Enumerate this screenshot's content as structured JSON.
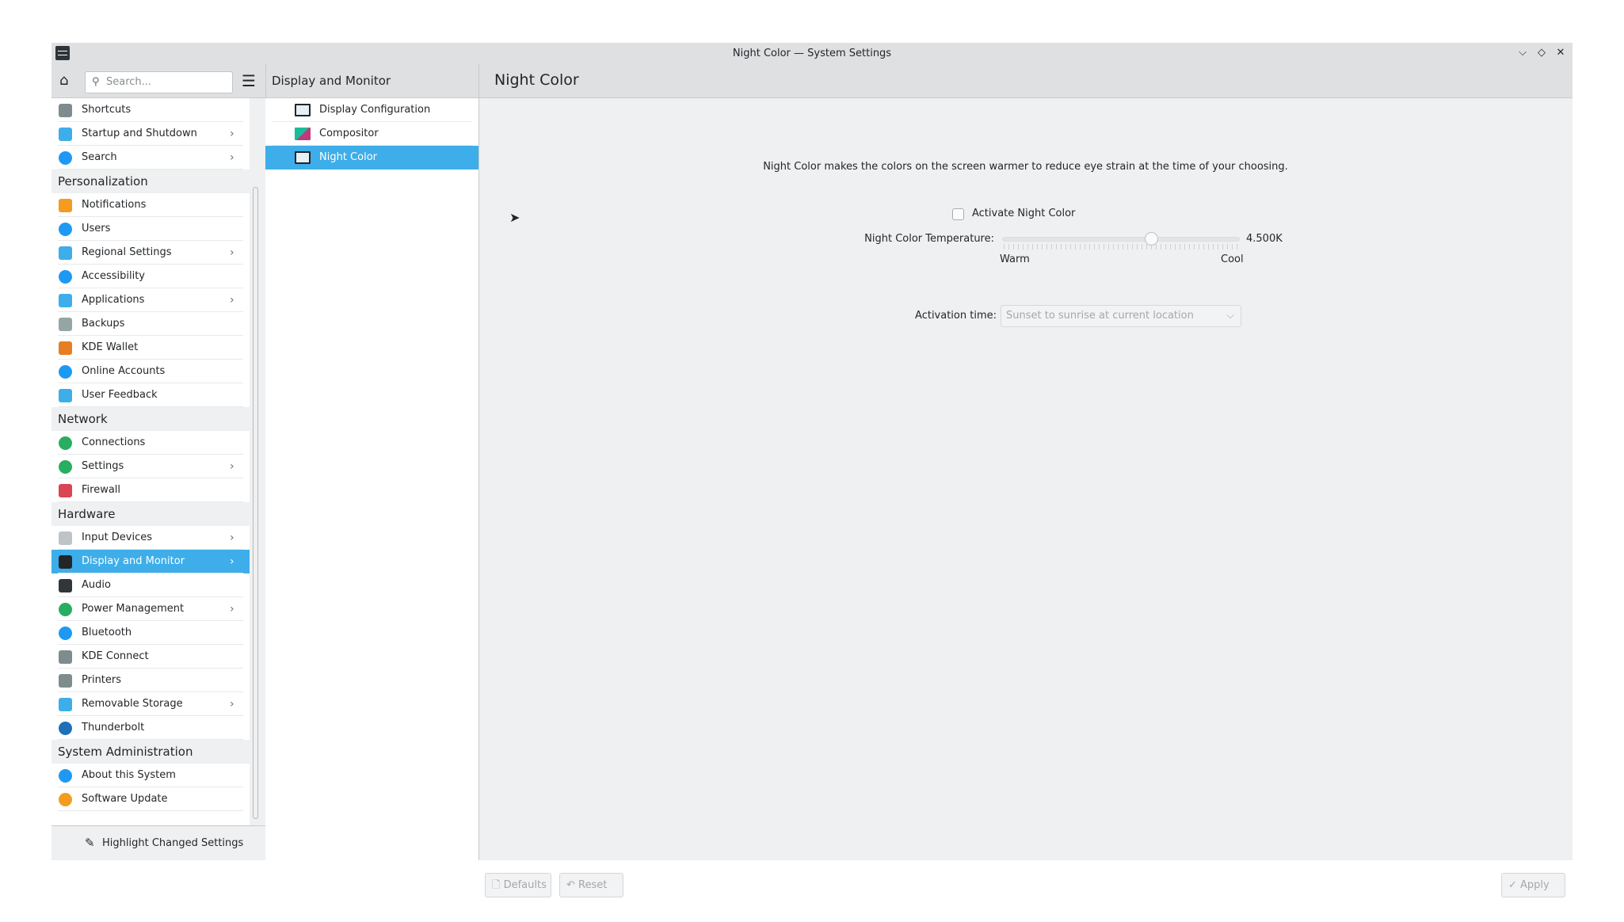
{
  "window": {
    "title": "Night Color — System Settings",
    "controls": {
      "minimize": "chevron-down-icon",
      "maximize": "diamond-icon",
      "close": "close-icon"
    }
  },
  "header": {
    "search_placeholder": "Search...",
    "middle_title": "Display and Monitor",
    "right_title": "Night Color"
  },
  "sidebar": {
    "rows": [
      {
        "type": "item",
        "label": "Shortcuts",
        "icon": "keyboard-icon",
        "color": "#7f8c8d"
      },
      {
        "type": "item",
        "label": "Startup and Shutdown",
        "icon": "monitor-icon",
        "color": "#3daee9",
        "chevron": true
      },
      {
        "type": "item",
        "label": "Search",
        "icon": "search-icon",
        "color": "#1d99f3",
        "chevron": true
      },
      {
        "type": "category",
        "label": "Personalization"
      },
      {
        "type": "item",
        "label": "Notifications",
        "icon": "bell-icon",
        "color": "#f39c1f"
      },
      {
        "type": "item",
        "label": "Users",
        "icon": "users-icon",
        "color": "#1d99f3"
      },
      {
        "type": "item",
        "label": "Regional Settings",
        "icon": "flag-icon",
        "color": "#3daee9",
        "chevron": true
      },
      {
        "type": "item",
        "label": "Accessibility",
        "icon": "accessibility-icon",
        "color": "#1d99f3"
      },
      {
        "type": "item",
        "label": "Applications",
        "icon": "apps-icon",
        "color": "#3daee9",
        "chevron": true
      },
      {
        "type": "item",
        "label": "Backups",
        "icon": "backup-icon",
        "color": "#95a5a6"
      },
      {
        "type": "item",
        "label": "KDE Wallet",
        "icon": "wallet-icon",
        "color": "#e67e22"
      },
      {
        "type": "item",
        "label": "Online Accounts",
        "icon": "globe-icon",
        "color": "#1d99f3"
      },
      {
        "type": "item",
        "label": "User Feedback",
        "icon": "feedback-icon",
        "color": "#3daee9"
      },
      {
        "type": "category",
        "label": "Network"
      },
      {
        "type": "item",
        "label": "Connections",
        "icon": "globe-icon",
        "color": "#27ae60"
      },
      {
        "type": "item",
        "label": "Settings",
        "icon": "globe-icon",
        "color": "#27ae60",
        "chevron": true
      },
      {
        "type": "item",
        "label": "Firewall",
        "icon": "firewall-icon",
        "color": "#da4453"
      },
      {
        "type": "category",
        "label": "Hardware"
      },
      {
        "type": "item",
        "label": "Input Devices",
        "icon": "mouse-icon",
        "color": "#bdc3c7",
        "chevron": true
      },
      {
        "type": "item",
        "label": "Display and Monitor",
        "icon": "monitor-icon",
        "color": "#232629",
        "chevron": true,
        "selected": true
      },
      {
        "type": "item",
        "label": "Audio",
        "icon": "speaker-icon",
        "color": "#31363b"
      },
      {
        "type": "item",
        "label": "Power Management",
        "icon": "power-icon",
        "color": "#27ae60",
        "chevron": true
      },
      {
        "type": "item",
        "label": "Bluetooth",
        "icon": "bluetooth-icon",
        "color": "#1d99f3"
      },
      {
        "type": "item",
        "label": "KDE Connect",
        "icon": "phone-icon",
        "color": "#7f8c8d"
      },
      {
        "type": "item",
        "label": "Printers",
        "icon": "printer-icon",
        "color": "#7f8c8d"
      },
      {
        "type": "item",
        "label": "Removable Storage",
        "icon": "usb-icon",
        "color": "#3daee9",
        "chevron": true
      },
      {
        "type": "item",
        "label": "Thunderbolt",
        "icon": "thunderbolt-icon",
        "color": "#1d6fb8"
      },
      {
        "type": "category",
        "label": "System Administration"
      },
      {
        "type": "item",
        "label": "About this System",
        "icon": "info-icon",
        "color": "#1d99f3"
      },
      {
        "type": "item",
        "label": "Software Update",
        "icon": "update-icon",
        "color": "#f39c1f"
      }
    ],
    "footer": "Highlight Changed Settings"
  },
  "middle": {
    "items": [
      {
        "label": "Display Configuration",
        "icon": "monitor-icon"
      },
      {
        "label": "Compositor",
        "icon": "compositor-icon"
      },
      {
        "label": "Night Color",
        "icon": "monitor-icon",
        "selected": true
      }
    ]
  },
  "content": {
    "description": "Night Color makes the colors on the screen warmer to reduce eye strain at the time of your choosing.",
    "activate_label": "Activate Night Color",
    "activate_checked": false,
    "temperature_label": "Night Color Temperature:",
    "temperature_value": "4.500K",
    "temperature_fraction": 0.63,
    "warm_label": "Warm",
    "cool_label": "Cool",
    "activation_label": "Activation time:",
    "activation_value": "Sunset to sunrise at current location"
  },
  "buttons": {
    "defaults": "Defaults",
    "reset": "Reset",
    "apply": "Apply"
  },
  "colors": {
    "accent": "#3daee9"
  }
}
